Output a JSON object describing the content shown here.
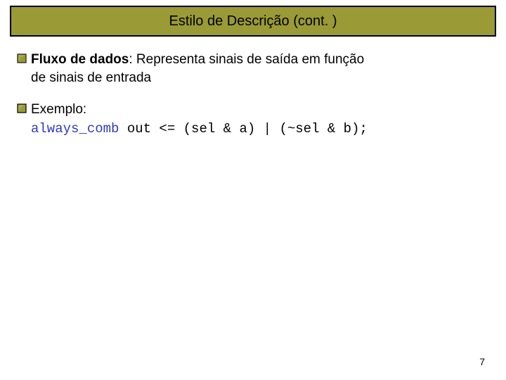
{
  "slide": {
    "title": "Estilo de Descrição (cont. )",
    "page_number": "7"
  },
  "bullets": [
    {
      "lead": "Fluxo de dados",
      "rest_first_line": ": Representa sinais de saída em função",
      "continuation": "de sinais de entrada"
    },
    {
      "lead": "",
      "rest_first_line": "Exemplo:",
      "continuation": ""
    }
  ],
  "code": {
    "keyword": "always_comb",
    "rest": " out <= (sel & a) | (~sel & b);"
  },
  "colors": {
    "title_bg": "#9a9a36",
    "title_border": "#000000",
    "bullet_fill": "#9a9a36",
    "bullet_stroke": "#000000",
    "code_keyword": "#2e3bbf"
  }
}
